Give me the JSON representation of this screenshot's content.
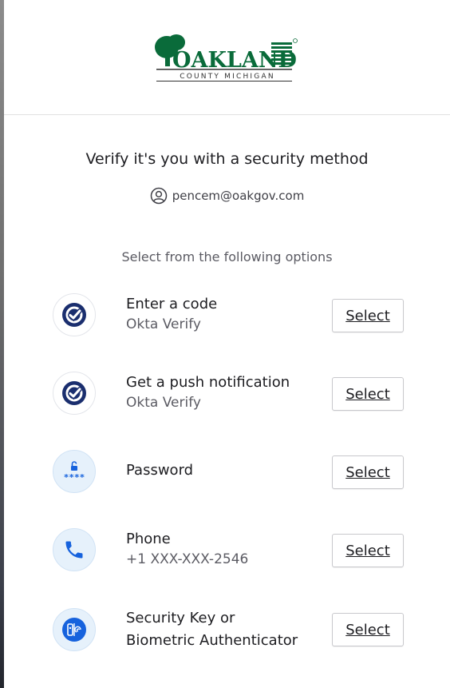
{
  "logo": {
    "name": "OAKLAND",
    "sub": "COUNTY MICHIGAN",
    "brand_color": "#0a6b3a"
  },
  "title": "Verify it's you with a security method",
  "identifier": {
    "icon": "user-icon",
    "email": "pencem@oakgov.com"
  },
  "subtitle": "Select from the following options",
  "options": [
    {
      "label": "Enter a code",
      "sub": "Okta Verify",
      "icon": "okta-verify-icon",
      "button": "Select"
    },
    {
      "label": "Get a push notification",
      "sub": "Okta Verify",
      "icon": "okta-verify-icon",
      "button": "Select"
    },
    {
      "label": "Password",
      "sub": "",
      "icon": "password-icon",
      "button": "Select"
    },
    {
      "label": "Phone",
      "sub": "+1 XXX-XXX-2546",
      "icon": "phone-icon",
      "button": "Select"
    },
    {
      "label": "Security Key or",
      "label2": "Biometric Authenticator",
      "sub": "",
      "icon": "security-key-icon",
      "button": "Select"
    }
  ],
  "colors": {
    "okta_navy": "#1a2e6e",
    "accent_blue": "#1662dd",
    "icon_bg": "#e6f1fb"
  }
}
